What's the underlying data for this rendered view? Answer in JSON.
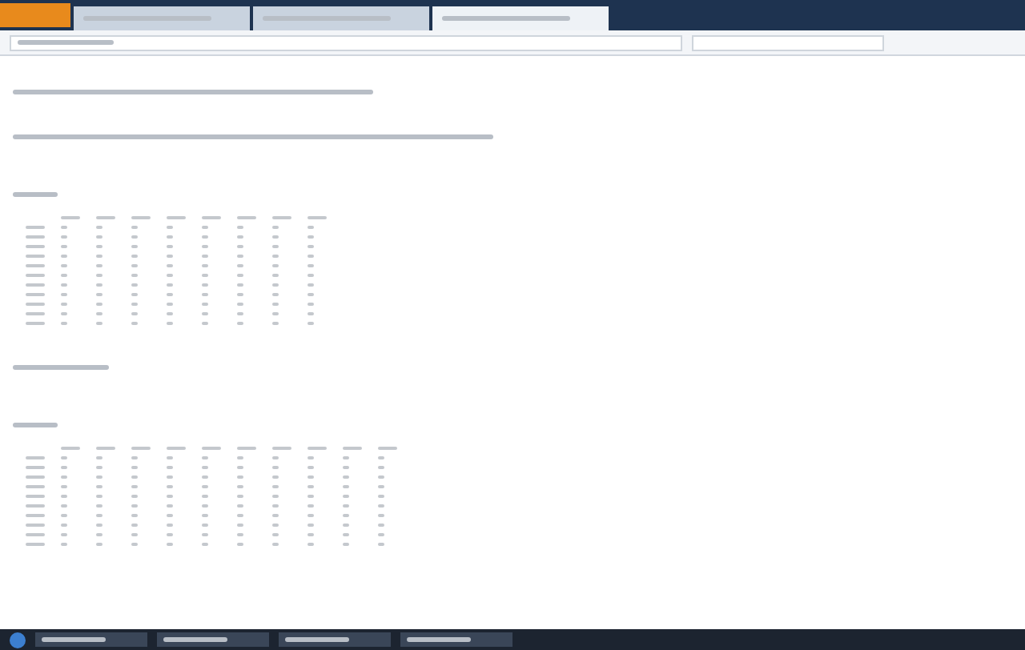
{
  "browser": {
    "tabs": [
      {
        "kind": "illegible",
        "selected": false
      },
      {
        "kind": "illegible",
        "selected": false
      },
      {
        "kind": "illegible",
        "selected": true
      }
    ]
  },
  "page": {
    "lines": [
      {
        "kind": "illegible"
      },
      {
        "kind": "illegible"
      }
    ],
    "tables": [
      {
        "heading": {
          "kind": "illegible"
        },
        "columns": [
          {
            "kind": "illegible"
          },
          {
            "kind": "illegible"
          },
          {
            "kind": "illegible"
          },
          {
            "kind": "illegible"
          },
          {
            "kind": "illegible"
          },
          {
            "kind": "illegible"
          },
          {
            "kind": "illegible"
          },
          {
            "kind": "illegible"
          },
          {
            "kind": "illegible"
          }
        ],
        "rows": [
          {
            "kind": "illegible"
          },
          {
            "kind": "illegible"
          },
          {
            "kind": "illegible"
          },
          {
            "kind": "illegible"
          },
          {
            "kind": "illegible"
          },
          {
            "kind": "illegible"
          },
          {
            "kind": "illegible"
          },
          {
            "kind": "illegible"
          },
          {
            "kind": "illegible"
          },
          {
            "kind": "illegible"
          },
          {
            "kind": "illegible"
          }
        ],
        "note": {
          "kind": "illegible"
        }
      },
      {
        "heading": {
          "kind": "illegible"
        },
        "columns": [
          {
            "kind": "illegible"
          },
          {
            "kind": "illegible"
          },
          {
            "kind": "illegible"
          },
          {
            "kind": "illegible"
          },
          {
            "kind": "illegible"
          },
          {
            "kind": "illegible"
          },
          {
            "kind": "illegible"
          },
          {
            "kind": "illegible"
          },
          {
            "kind": "illegible"
          },
          {
            "kind": "illegible"
          },
          {
            "kind": "illegible"
          }
        ],
        "rows": [
          {
            "kind": "illegible"
          },
          {
            "kind": "illegible"
          },
          {
            "kind": "illegible"
          },
          {
            "kind": "illegible"
          },
          {
            "kind": "illegible"
          },
          {
            "kind": "illegible"
          },
          {
            "kind": "illegible"
          },
          {
            "kind": "illegible"
          },
          {
            "kind": "illegible"
          },
          {
            "kind": "illegible"
          }
        ]
      }
    ]
  },
  "taskbar": {
    "items": [
      {
        "kind": "illegible"
      },
      {
        "kind": "illegible"
      },
      {
        "kind": "illegible"
      },
      {
        "kind": "illegible"
      }
    ]
  }
}
